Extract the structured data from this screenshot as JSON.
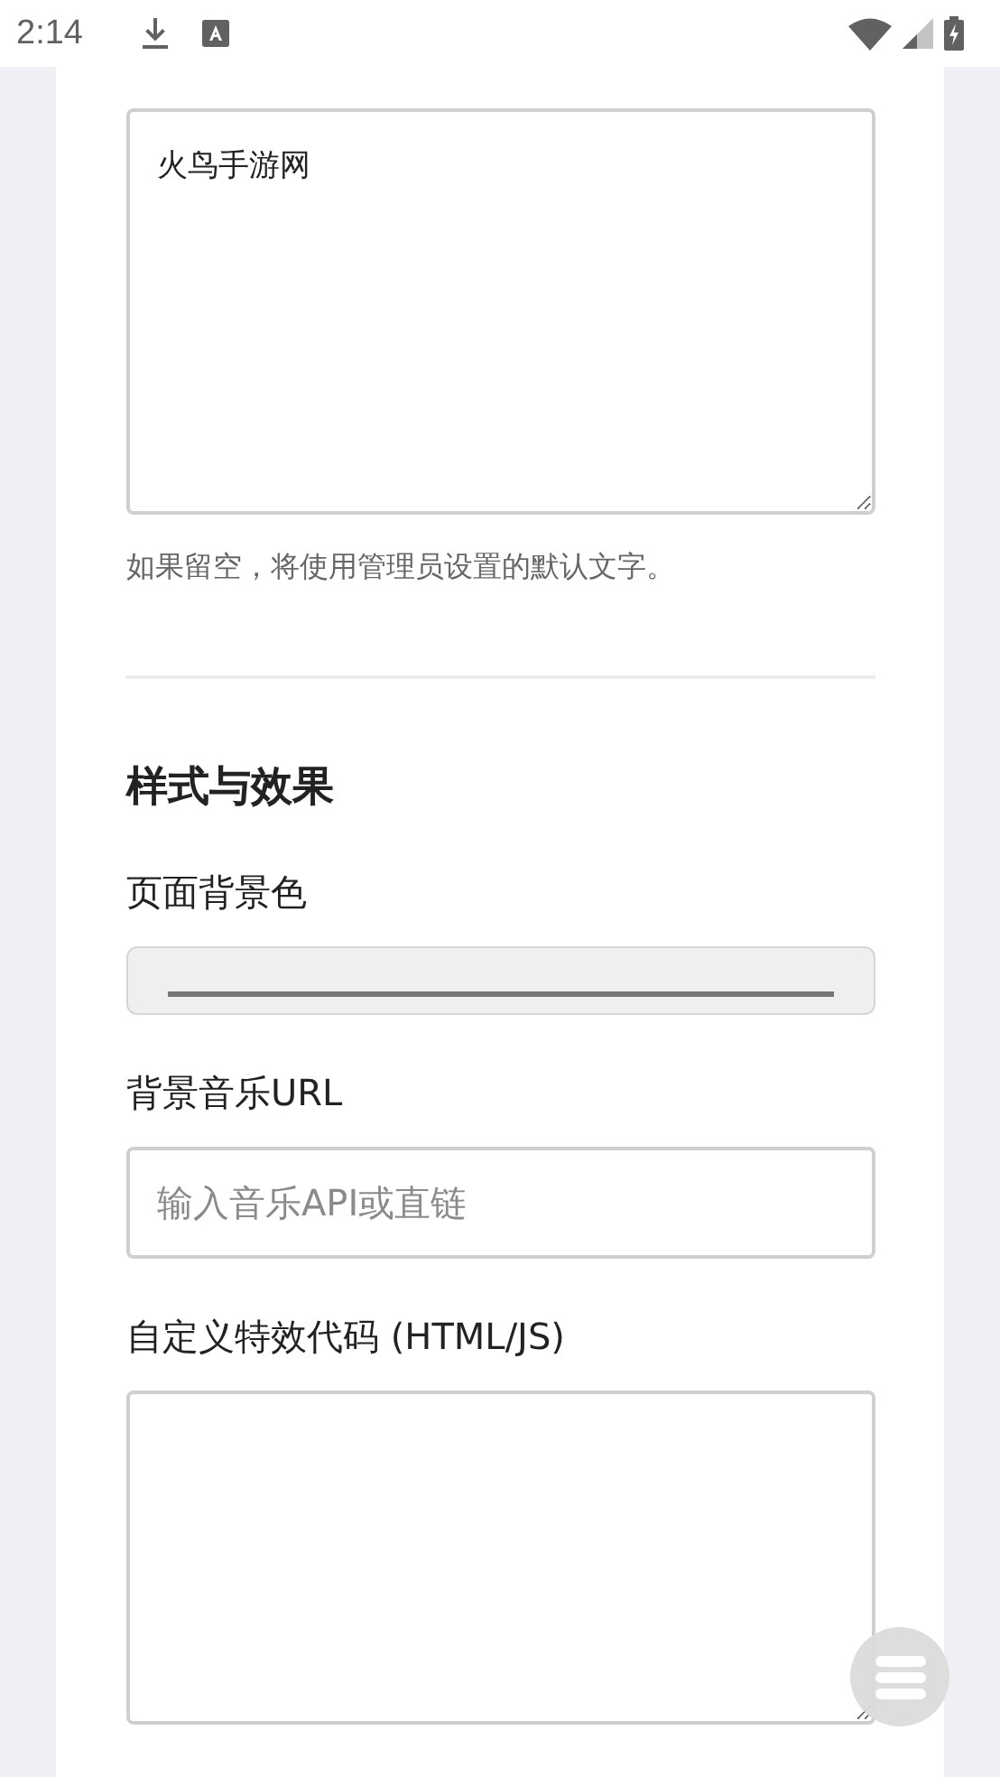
{
  "status_bar": {
    "time": "2:14"
  },
  "form": [
    {
      "kind": "textarea",
      "value": "火鸟手游网",
      "hint": "如果留空，将使用管理员设置的默认文字。"
    },
    {
      "kind": "divider"
    },
    {
      "kind": "heading",
      "text": "样式与效果"
    },
    {
      "kind": "label",
      "text": "页面背景色"
    },
    {
      "kind": "color"
    },
    {
      "kind": "label",
      "text": "背景音乐URL"
    },
    {
      "kind": "input",
      "placeholder": "输入音乐API或直链"
    },
    {
      "kind": "label",
      "text": "自定义特效代码 (HTML/JS)"
    },
    {
      "kind": "code"
    }
  ]
}
